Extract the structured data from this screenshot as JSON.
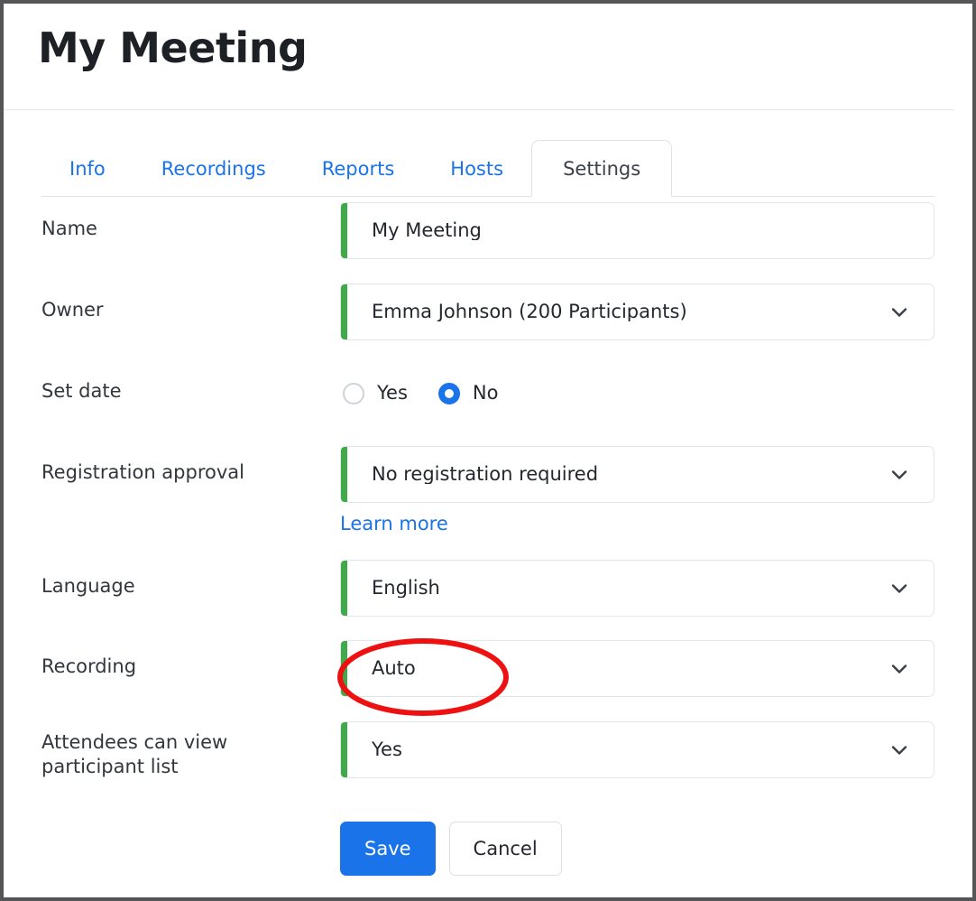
{
  "header": {
    "title": "My Meeting"
  },
  "tabs": [
    {
      "label": "Info",
      "active": false
    },
    {
      "label": "Recordings",
      "active": false
    },
    {
      "label": "Reports",
      "active": false
    },
    {
      "label": "Hosts",
      "active": false
    },
    {
      "label": "Settings",
      "active": true
    }
  ],
  "form": {
    "name": {
      "label": "Name",
      "value": "My Meeting",
      "placeholder": "Name"
    },
    "owner": {
      "label": "Owner",
      "value": "Emma Johnson (200 Participants)"
    },
    "set_date": {
      "label": "Set date",
      "options": [
        {
          "label": "Yes",
          "selected": false
        },
        {
          "label": "No",
          "selected": true
        }
      ]
    },
    "registration_approval": {
      "label": "Registration approval",
      "value": "No registration required",
      "link_label": "Learn more"
    },
    "language": {
      "label": "Language",
      "value": "English"
    },
    "recording": {
      "label": "Recording",
      "value": "Auto"
    },
    "attendees_view_participant_list": {
      "label": "Attendees can view participant list",
      "value": "Yes"
    }
  },
  "actions": {
    "save_label": "Save",
    "cancel_label": "Cancel"
  },
  "colors": {
    "accent_green": "#40a94a",
    "link_blue": "#1a73e8",
    "primary_button": "#1a73e8",
    "annotation_red": "#ee1111",
    "title_text": "#1d2126",
    "border_gray": "#e3e6e9",
    "window_border": "#555558"
  },
  "icons": {
    "chevron": "chevron-down-icon",
    "annotation": "red-ellipse-highlight"
  }
}
